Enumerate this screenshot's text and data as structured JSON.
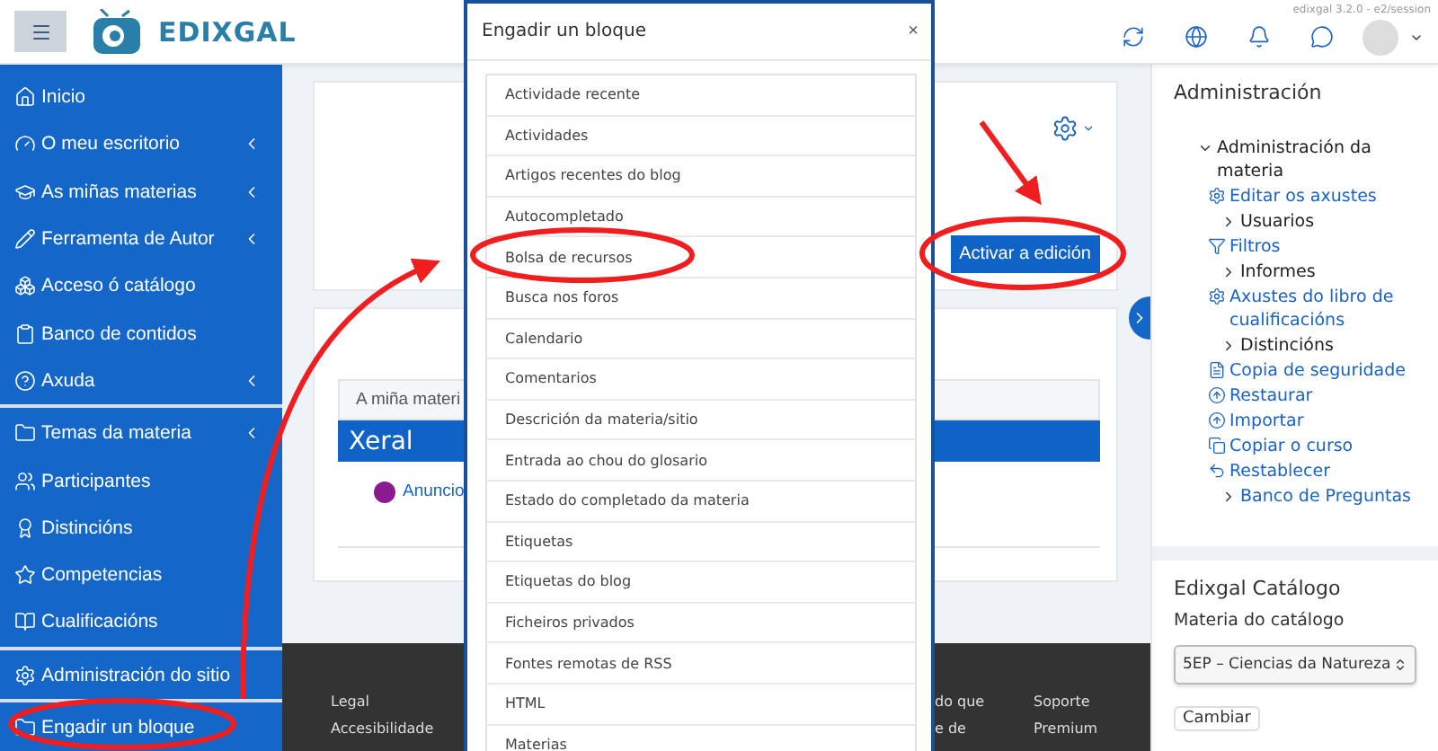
{
  "header": {
    "logo_text": "EDIXGAL",
    "version": "edixgal 3.2.0 - e2/session"
  },
  "sidebar": {
    "sections": [
      [
        {
          "label": "Inicio",
          "submenu": false
        },
        {
          "label": "O meu escritorio",
          "submenu": true
        },
        {
          "label": "As miñas materias",
          "submenu": true
        },
        {
          "label": "Ferramenta de Autor",
          "submenu": true
        },
        {
          "label": "Acceso ó catálogo",
          "submenu": false
        },
        {
          "label": "Banco de contidos",
          "submenu": false
        },
        {
          "label": "Axuda",
          "submenu": true
        }
      ],
      [
        {
          "label": "Temas da materia",
          "submenu": true
        },
        {
          "label": "Participantes",
          "submenu": false
        },
        {
          "label": "Distincións",
          "submenu": false
        },
        {
          "label": "Competencias",
          "submenu": false
        },
        {
          "label": "Cualificacións",
          "submenu": false
        }
      ],
      [
        {
          "label": "Administración do sitio",
          "submenu": false
        }
      ],
      [
        {
          "label": "Engadir un bloque",
          "submenu": false
        }
      ]
    ]
  },
  "course": {
    "edit_button": "Activar a edición",
    "tab": "A miña materi",
    "section_title": "Xeral",
    "activities": [
      {
        "label": "Anuncio"
      }
    ]
  },
  "footer": {
    "columns": [
      [
        "Legal",
        "Accesibilidade"
      ],
      [
        "do que",
        "e de"
      ],
      [
        "Soporte",
        "Premium"
      ]
    ]
  },
  "modal": {
    "title": "Engadir un bloque",
    "close": "×",
    "items": [
      {
        "label": "Actividade recente"
      },
      {
        "label": "Actividades"
      },
      {
        "label": "Artigos recentes do blog"
      },
      {
        "label": "Autocompletado"
      },
      {
        "label": "Bolsa de recursos"
      },
      {
        "label": "Busca nos foros"
      },
      {
        "label": "Calendario"
      },
      {
        "label": "Comentarios"
      },
      {
        "label": "Descrición da materia/sitio"
      },
      {
        "label": "Entrada ao chou do glosario"
      },
      {
        "label": "Estado do completado da materia"
      },
      {
        "label": "Etiquetas"
      },
      {
        "label": "Etiquetas do blog"
      },
      {
        "label": "Ficheiros privados"
      },
      {
        "label": "Fontes remotas de RSS"
      },
      {
        "label": "HTML"
      },
      {
        "label": "Materias"
      }
    ]
  },
  "administration": {
    "title": "Administración",
    "tree": [
      {
        "label": "Administración da materia",
        "kind": "branch",
        "link": false,
        "expanded": true,
        "children": [
          {
            "label": "Editar os axustes",
            "kind": "link"
          },
          {
            "label": "Usuarios",
            "kind": "branch",
            "link": false,
            "expanded": false
          },
          {
            "label": "Filtros",
            "kind": "link"
          },
          {
            "label": "Informes",
            "kind": "branch",
            "link": false,
            "expanded": false
          },
          {
            "label": "Axustes do libro de cualificacións",
            "kind": "link"
          },
          {
            "label": "Distincións",
            "kind": "branch",
            "link": false,
            "expanded": false
          },
          {
            "label": "Copia de seguridade",
            "kind": "link"
          },
          {
            "label": "Restaurar",
            "kind": "link"
          },
          {
            "label": "Importar",
            "kind": "link"
          },
          {
            "label": "Copiar o curso",
            "kind": "link"
          },
          {
            "label": "Restablecer",
            "kind": "link"
          },
          {
            "label": "Banco de Preguntas",
            "kind": "branch",
            "link": true,
            "expanded": false
          }
        ]
      }
    ]
  },
  "catalog": {
    "title": "Edixgal Catálogo",
    "field_label": "Materia do catálogo",
    "value": "5EP – Ciencias da Natureza",
    "button": "Cambiar"
  }
}
